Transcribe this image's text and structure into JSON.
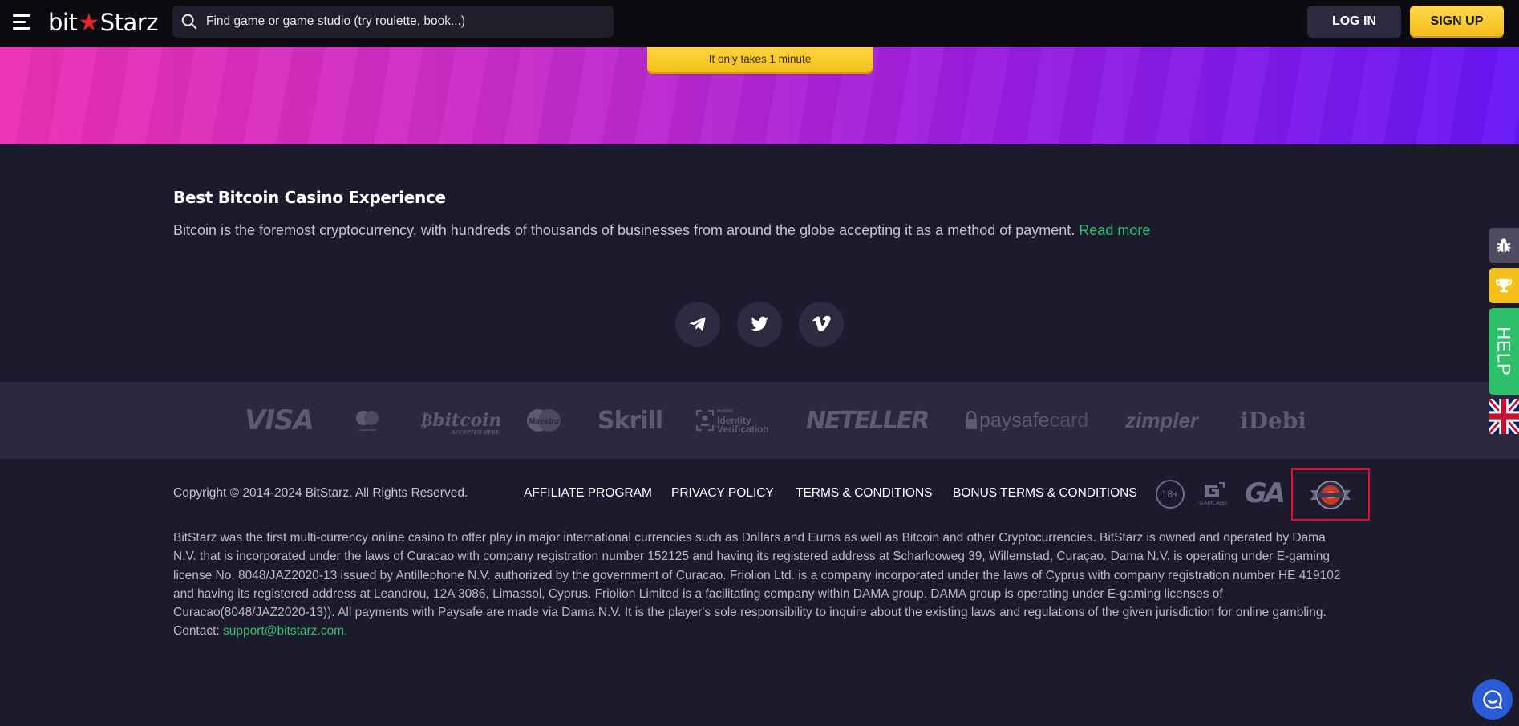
{
  "header": {
    "logo_left": "bit",
    "logo_star": "★",
    "logo_right": "Starz",
    "search_placeholder": "Find game or game studio (try roulette, book...)",
    "login_label": "LOG IN",
    "signup_label": "SIGN UP"
  },
  "banner": {
    "cta_text": "It only takes 1 minute"
  },
  "seo": {
    "title": "Best Bitcoin Casino Experience",
    "text": "Bitcoin is the foremost cryptocurrency, with hundreds of thousands of businesses from around the globe accepting it as a method of payment.",
    "read_more": "Read more"
  },
  "social": [
    "telegram-icon",
    "twitter-icon",
    "vimeo-icon"
  ],
  "payments": {
    "visa": "VISA",
    "mastercard_caption": "mastercard",
    "bitcoin": "bitcoin",
    "bitcoin_caption": "ACCEPTED HERE",
    "maestro": "Maestro",
    "skrill": "Skrill",
    "idv_line1": "mobile",
    "idv_line2": "Identity",
    "idv_line3": "Verification",
    "neteller": "NETELLER",
    "paysafe_a": "paysafe",
    "paysafe_b": "card",
    "zimpler": "zimpler",
    "idebit": "iDebi"
  },
  "footer": {
    "copyright": "Copyright © 2014-2024 BitStarz. All Rights Reserved.",
    "links": {
      "affiliate": "AFFILIATE PROGRAM",
      "privacy": "PRIVACY POLICY",
      "terms": "TERMS & CONDITIONS",
      "bonus_terms": "BONUS TERMS & CONDITIONS"
    },
    "badges": {
      "age": "18+",
      "gamcare": "GAMCARE",
      "ga": "GA"
    },
    "legal_text": "BitStarz was the first multi-currency online casino to offer play in major international currencies such as Dollars and Euros as well as Bitcoin and other Cryptocurrencies. BitStarz is owned and operated by Dama N.V. that is incorporated under the laws of Curacao with company registration number 152125 and having its registered address at Scharlooweg 39, Willemstad, Curaçao. Dama N.V. is operating under E-gaming license No. 8048/JAZ2020-13 issued by Antillephone N.V. authorized by the government of Curacao. Friolion Ltd. is a company incorporated under the laws of Cyprus with company registration number HE 419102 and having its registered address at Leandrou, 12A 3086, Limassol, Cyprus. Friolion Limited is a facilitating company within DAMA group. DAMA group is operating under E-gaming licenses of Curacao(8048/JAZ2020-13)). All payments with Paysafe are made via Dama N.V. It is the player's sole responsibility to inquire about the existing laws and regulations of the given jurisdiction for online gambling. Contact: ",
    "contact_email": "support@bitstarz.com."
  },
  "rail": {
    "help_label": "HELP"
  },
  "colors": {
    "accent_green": "#2ec06a",
    "accent_yellow": "#f3c01c",
    "background": "#1c1b2e",
    "highlight_red": "#e0102a"
  }
}
